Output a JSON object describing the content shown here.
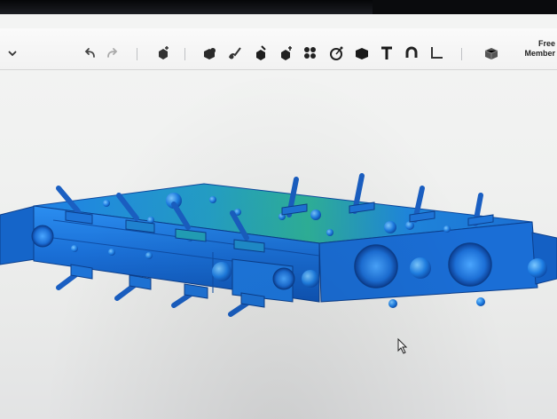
{
  "app": {
    "toolbar": {
      "menu_chevron": "chevron-down-icon",
      "undo": "undo-icon",
      "redo": "redo-icon",
      "tools": [
        "add-solid-icon",
        "shape-icon",
        "paint-brush-icon",
        "fill-icon",
        "move-icon",
        "pattern-icon",
        "snap-icon",
        "box-icon",
        "text-icon",
        "magnet-icon",
        "measure-icon",
        "material-cube-icon"
      ],
      "right_label_line1": "Free",
      "right_label_line2": "Member"
    },
    "viewport": {
      "model_color": "#1f78d8",
      "highlight_color": "#22b3a0",
      "background_color": "#eef0ef",
      "cursor": "mouse-pointer-icon"
    }
  }
}
